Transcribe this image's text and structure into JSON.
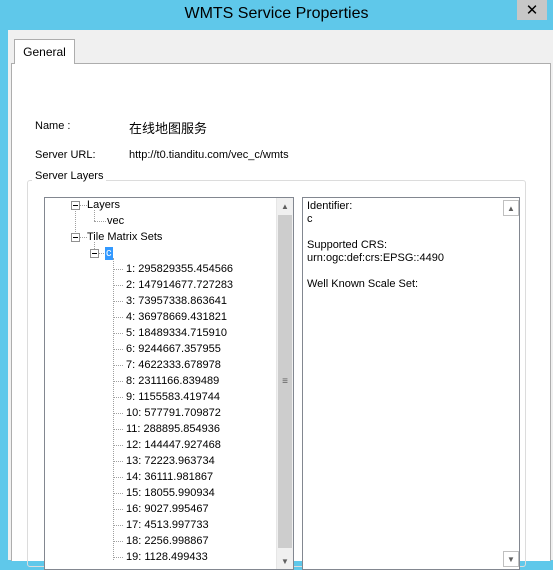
{
  "window": {
    "title": "WMTS Service Properties",
    "close_glyph": "✕"
  },
  "tabs": [
    {
      "label": "General",
      "selected": true
    }
  ],
  "fields": {
    "name_label": "Name :",
    "name_value": "在线地图服务",
    "url_label": "Server URL:",
    "url_value": "http://t0.tianditu.com/vec_c/wmts"
  },
  "group": {
    "title": "Server Layers"
  },
  "tree": {
    "layers_label": "Layers",
    "layer_item": "vec",
    "tms_label": "Tile Matrix Sets",
    "tms_item": "c",
    "scales": [
      "1: 295829355.454566",
      "2: 147914677.727283",
      "3: 73957338.863641",
      "4: 36978669.431821",
      "5: 18489334.715910",
      "6: 9244667.357955",
      "7: 4622333.678978",
      "8: 2311166.839489",
      "9: 1155583.419744",
      "10: 577791.709872",
      "11: 288895.854936",
      "12: 144447.927468",
      "13: 72223.963734",
      "14: 36111.981867",
      "15: 18055.990934",
      "16: 9027.995467",
      "17: 4513.997733",
      "18: 2256.998867",
      "19: 1128.499433"
    ]
  },
  "details": {
    "identifier_label": "Identifier:",
    "identifier_value": "c",
    "crs_label": "Supported CRS:",
    "crs_value": "urn:ogc:def:crs:EPSG::4490",
    "wkss_label": "Well Known Scale Set:"
  },
  "scroll": {
    "up": "▲",
    "down": "▼",
    "grip": "≡"
  },
  "colors": {
    "titlebar": "#5fc8ea",
    "selection": "#3399ff"
  }
}
